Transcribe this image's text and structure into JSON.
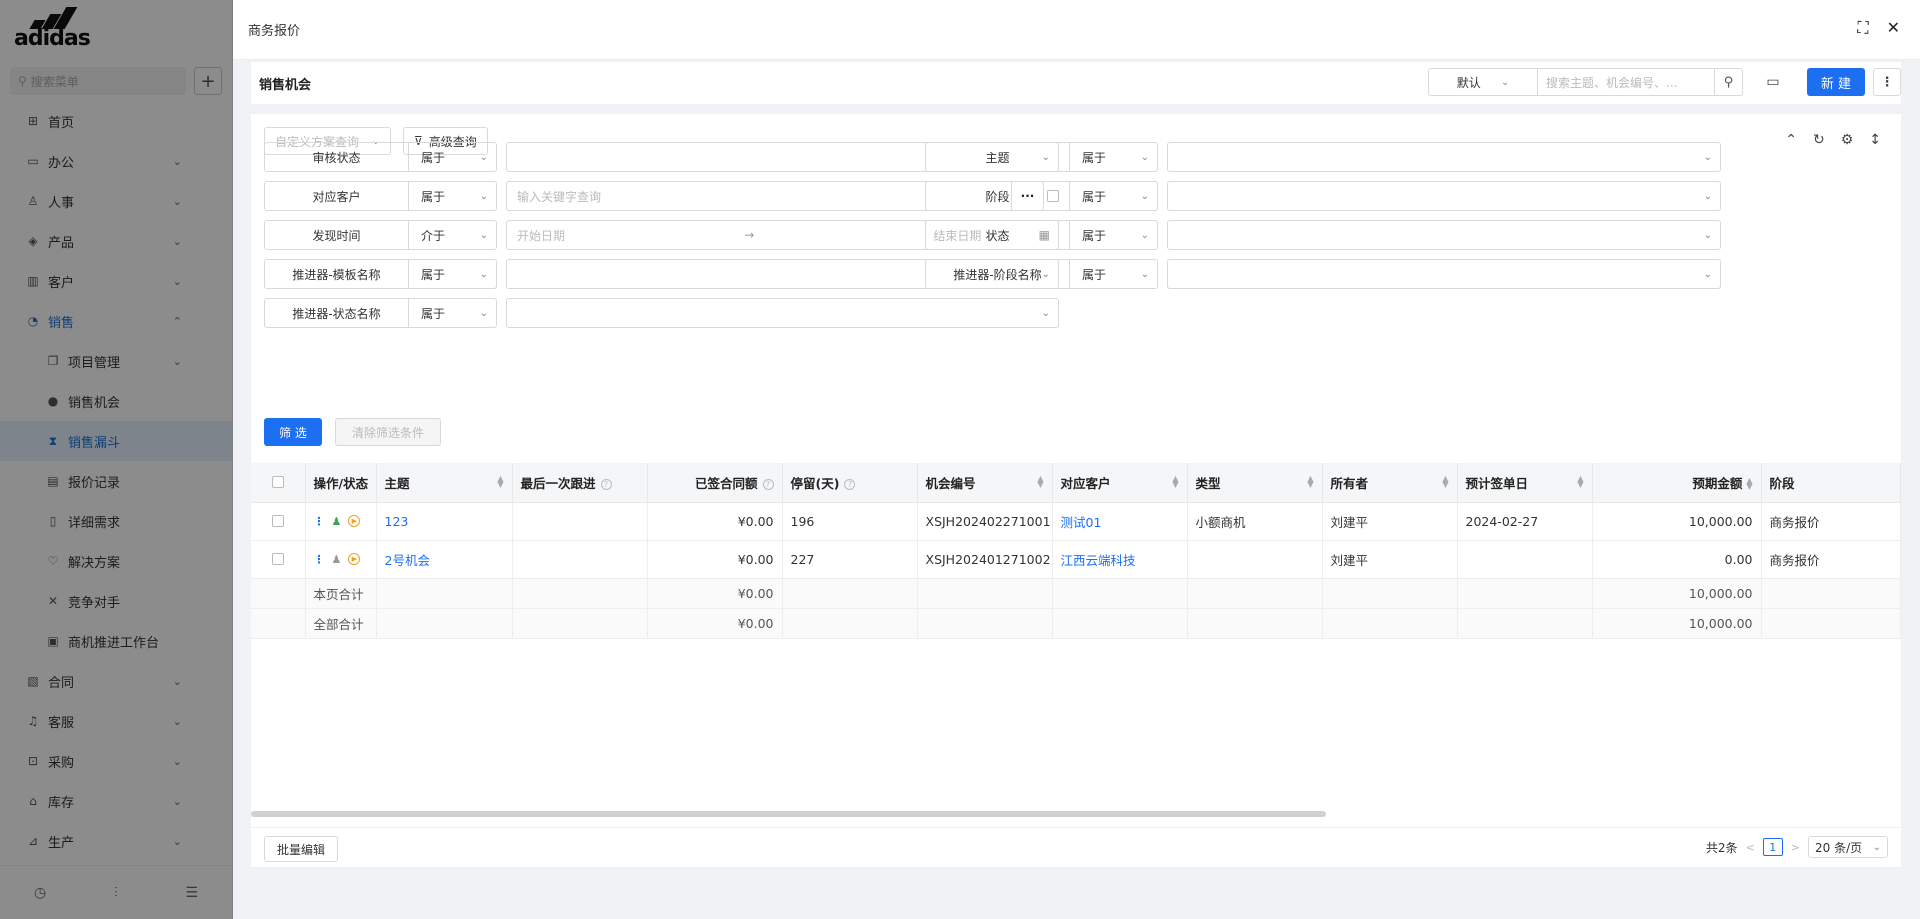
{
  "sidebar": {
    "brand": "adidas",
    "search_placeholder": "搜索菜单",
    "items": [
      {
        "label": "首页"
      },
      {
        "label": "办公"
      },
      {
        "label": "人事"
      },
      {
        "label": "产品"
      },
      {
        "label": "客户"
      },
      {
        "label": "销售"
      },
      {
        "label": "项目管理"
      },
      {
        "label": "销售机会"
      },
      {
        "label": "销售漏斗"
      },
      {
        "label": "报价记录"
      },
      {
        "label": "详细需求"
      },
      {
        "label": "解决方案"
      },
      {
        "label": "竞争对手"
      },
      {
        "label": "商机推进工作台"
      },
      {
        "label": "合同"
      },
      {
        "label": "客服"
      },
      {
        "label": "采购"
      },
      {
        "label": "库存"
      },
      {
        "label": "生产"
      }
    ]
  },
  "drawer": {
    "title": "商务报价"
  },
  "toolbar": {
    "page_title": "销售机会",
    "view_select": "默认",
    "search_placeholder": "搜索主题、机会编号、...",
    "new_label": "新 建"
  },
  "query": {
    "custom_scheme_placeholder": "自定义方案查询",
    "advanced_label": "高级查询"
  },
  "filters": {
    "audit_status": {
      "label": "审核状态",
      "op": "属于"
    },
    "subject": {
      "label": "主题",
      "op": "属于"
    },
    "customer": {
      "label": "对应客户",
      "op": "属于",
      "placeholder": "输入关键字查询"
    },
    "stage": {
      "label": "阶段",
      "op": "属于"
    },
    "found_time": {
      "label": "发现时间",
      "op": "介于",
      "start_placeholder": "开始日期",
      "end_placeholder": "结束日期"
    },
    "status": {
      "label": "状态",
      "op": "属于"
    },
    "promoter_template": {
      "label": "推进器-模板名称",
      "op": "属于"
    },
    "promoter_stage": {
      "label": "推进器-阶段名称",
      "op": "属于"
    },
    "promoter_status": {
      "label": "推进器-状态名称",
      "op": "属于"
    },
    "filter_label": "筛 选",
    "clear_label": "清除筛选条件"
  },
  "table": {
    "headers": {
      "ops": "操作/状态",
      "subject": "主题",
      "last_follow": "最后一次跟进",
      "signed_amount": "已签合同额",
      "stay_days": "停留(天)",
      "opp_no": "机会编号",
      "customer": "对应客户",
      "type": "类型",
      "owner": "所有者",
      "expected_date": "预计签单日",
      "expected_amount": "预期金额",
      "stage": "阶段"
    },
    "rows": [
      {
        "subject": "123",
        "last_follow": "",
        "signed_amount": "¥0.00",
        "stay_days": "196",
        "opp_no": "XSJH202402271001",
        "customer": "测试01",
        "type": "小额商机",
        "owner": "刘建平",
        "expected_date": "2024-02-27",
        "expected_amount": "10,000.00",
        "stage": "商务报价"
      },
      {
        "subject": "2号机会",
        "last_follow": "",
        "signed_amount": "¥0.00",
        "stay_days": "227",
        "opp_no": "XSJH202401271002",
        "customer": "江西云端科技",
        "type": "",
        "owner": "刘建平",
        "expected_date": "",
        "expected_amount": "0.00",
        "stage": "商务报价"
      }
    ],
    "page_total": {
      "label": "本页合计",
      "signed_amount": "¥0.00",
      "expected_amount": "10,000.00"
    },
    "all_total": {
      "label": "全部合计",
      "signed_amount": "¥0.00",
      "expected_amount": "10,000.00"
    }
  },
  "footer": {
    "batch_edit": "批量编辑",
    "total_text": "共2条",
    "current_page": "1",
    "page_size": "20 条/页"
  }
}
